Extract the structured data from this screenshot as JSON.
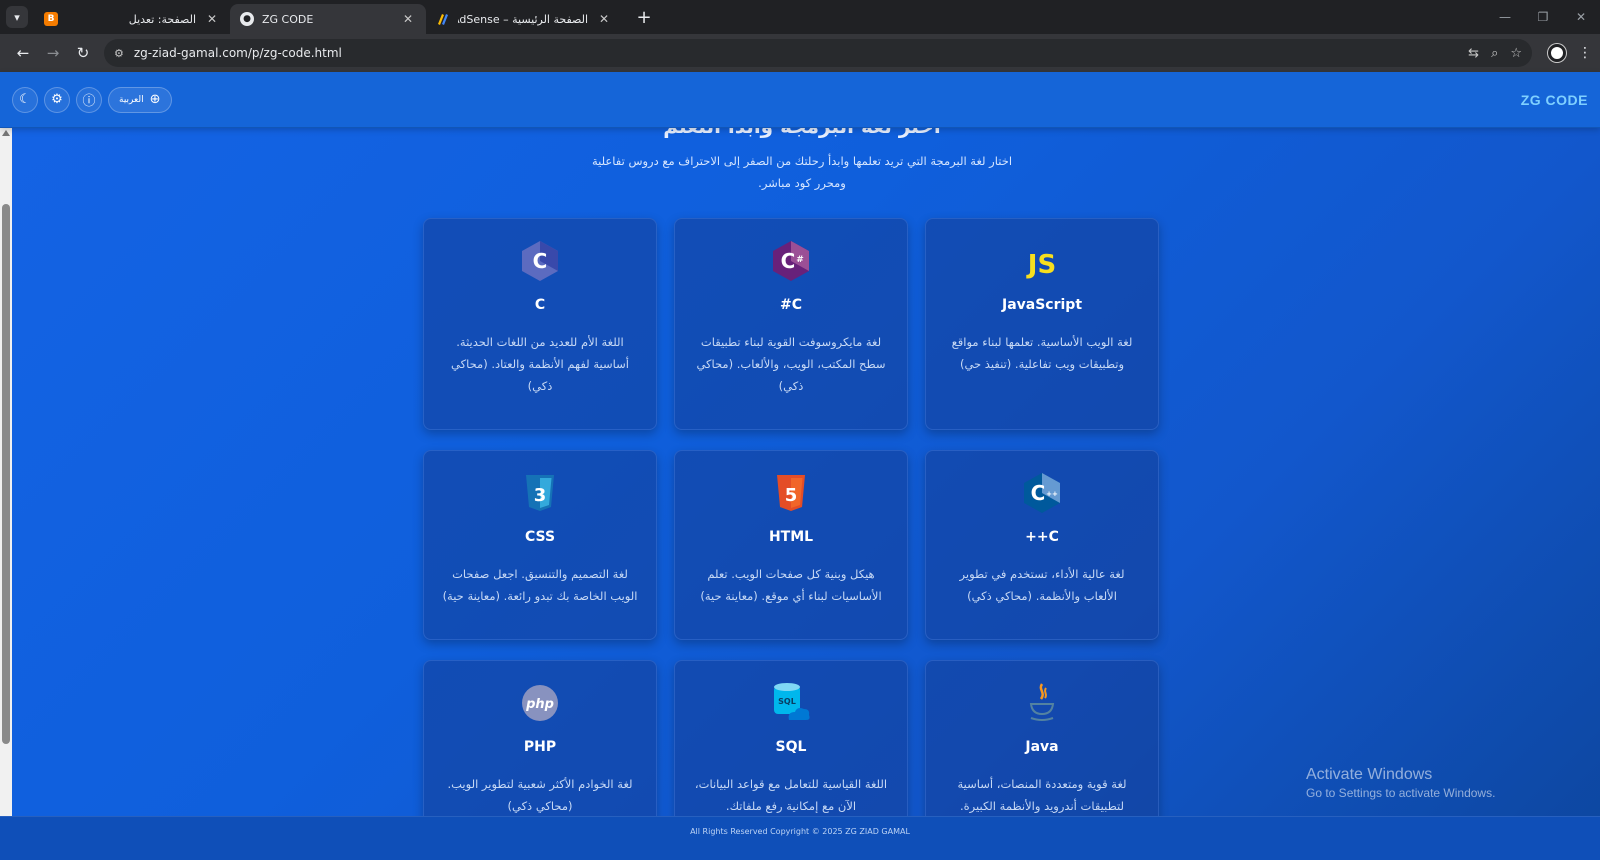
{
  "browser": {
    "tabs": [
      {
        "title": "الصفحة: تعديل",
        "active": false
      },
      {
        "title": "ZG CODE",
        "active": true
      },
      {
        "title": "الصفحة الرئيسية – Google AdSense",
        "active": false
      }
    ],
    "url": "zg-ziad-gamal.com/p/zg-code.html"
  },
  "header": {
    "lang_label": "العربية",
    "brand": "ZG CODE"
  },
  "hero": {
    "title": "اختر لغة البرمجة وابدأ التعلم",
    "subtitle": "اختار لغة البرمجة التي تريد تعلمها وابدأ رحلتك من الصفر إلى الاحتراف مع دروس تفاعلية ومحرر كود مباشر."
  },
  "languages": [
    {
      "name": "C",
      "desc": "اللغة الأم للعديد من اللغات الحديثة. أساسية لفهم الأنظمة والعتاد. (محاكي ذكي)"
    },
    {
      "name": "#C",
      "desc": "لغة مايكروسوفت القوية لبناء تطبيقات سطح المكتب، الويب، والألعاب. (محاكي ذكي)"
    },
    {
      "name": "JavaScript",
      "desc": "لغة الويب الأساسية. تعلمها لبناء مواقع وتطبيقات ويب تفاعلية. (تنفيذ حي)"
    },
    {
      "name": "CSS",
      "desc": "لغة التصميم والتنسيق. اجعل صفحات الويب الخاصة بك تبدو رائعة. (معاينة حية)"
    },
    {
      "name": "HTML",
      "desc": "هيكل وبنية كل صفحات الويب. تعلم الأساسيات لبناء أي موقع. (معاينة حية)"
    },
    {
      "name": "++C",
      "desc": "لغة عالية الأداء، تستخدم في تطوير الألعاب والأنظمة. (محاكي ذكي)"
    },
    {
      "name": "PHP",
      "desc": "لغة الخوادم الأكثر شعبية لتطوير الويب. (محاكي ذكي)"
    },
    {
      "name": "SQL",
      "desc": "اللغة القياسية للتعامل مع قواعد البيانات، الآن مع إمكانية رفع ملفاتك."
    },
    {
      "name": "Java",
      "desc": "لغة قوية ومتعددة المنصات، أساسية لتطبيقات أندرويد والأنظمة الكبيرة."
    }
  ],
  "watermark": {
    "line1": "Activate Windows",
    "line2": "Go to Settings to activate Windows."
  },
  "footer": {
    "copyright": "All Rights Reserved Copyright © 2025 ZG ZIAD GAMAL"
  },
  "colors": {
    "accent": "#1a73e8",
    "brand": "#7fd0ff"
  }
}
